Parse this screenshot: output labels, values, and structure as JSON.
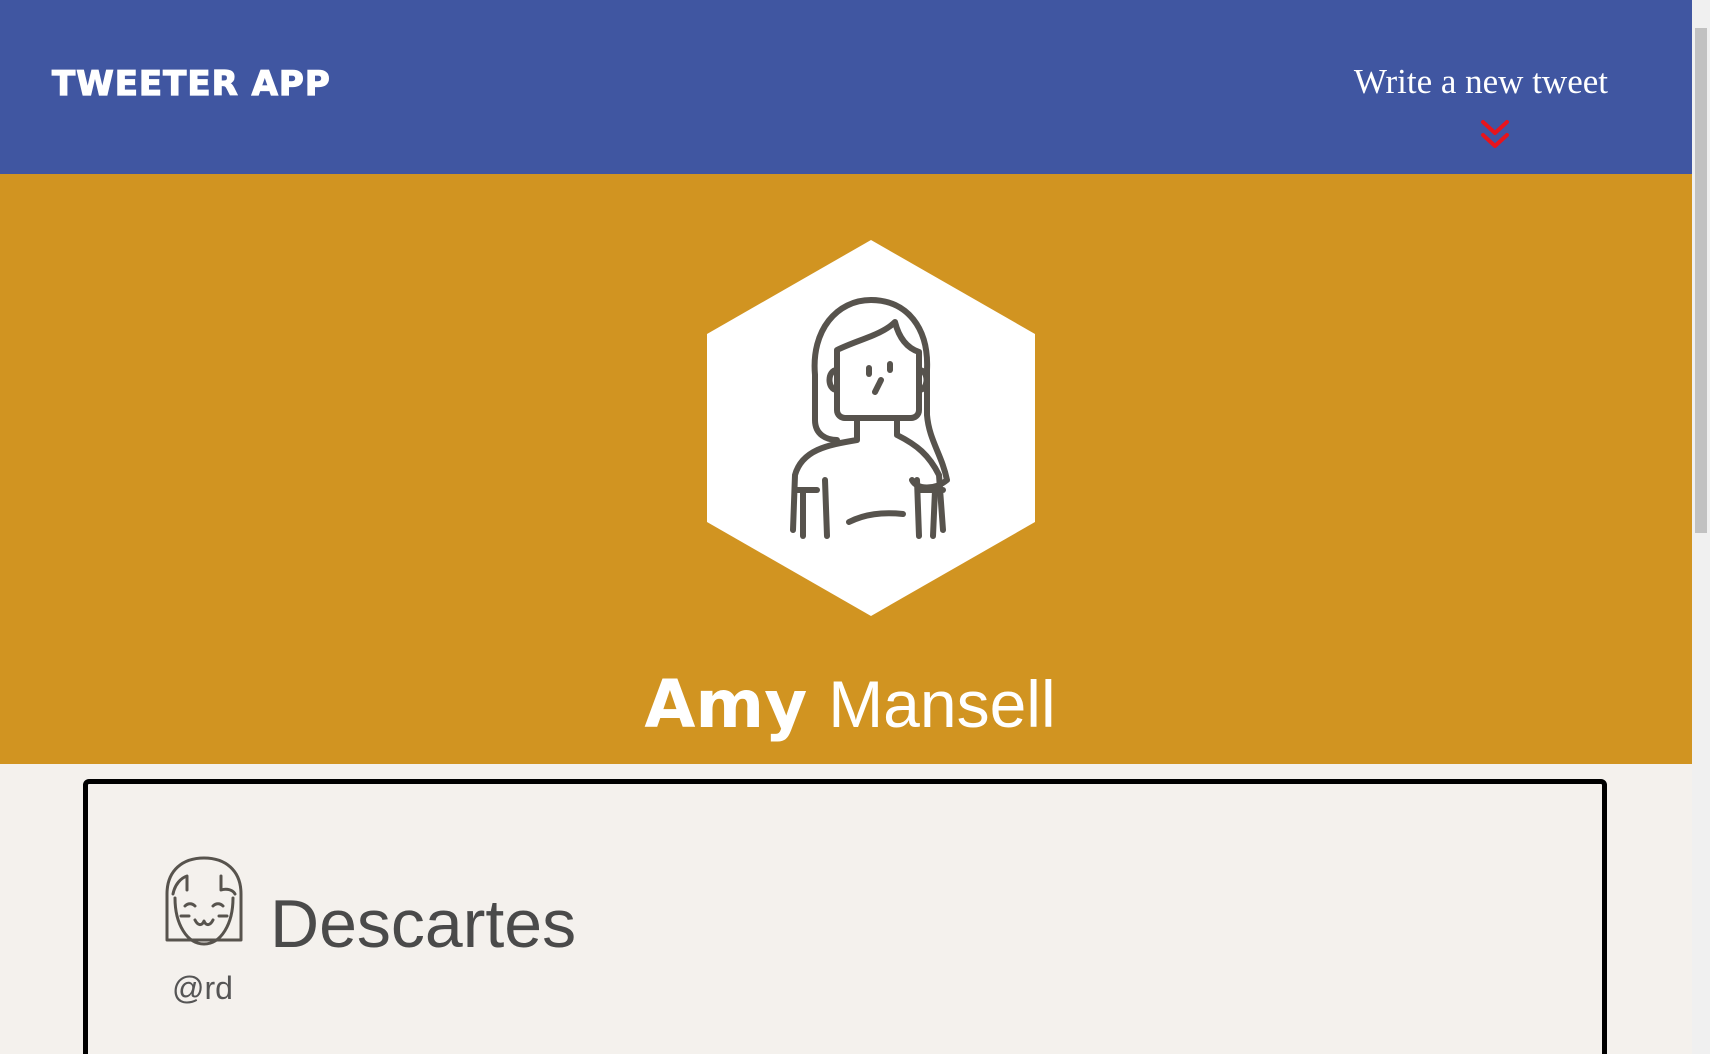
{
  "nav": {
    "brand": "TWEETER APP",
    "compose_label": "Write a new tweet",
    "compose_icon": "double-chevron-down-icon"
  },
  "profile": {
    "first_name": "Amy",
    "last_name": "Mansell",
    "avatar_icon": "woman-avatar-icon"
  },
  "tweet": {
    "author": "Descartes",
    "handle": "@rd",
    "avatar_icon": "girl-avatar-icon"
  },
  "colors": {
    "nav_bg": "#4056a1",
    "profile_bg": "#d19421",
    "page_bg": "#f4f1ed",
    "accent": "#e8141c"
  }
}
